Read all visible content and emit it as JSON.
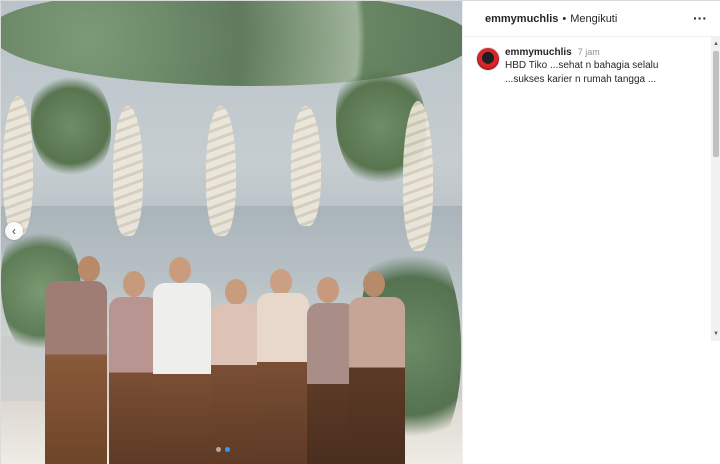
{
  "post": {
    "header": {
      "username": "emmymuchlis",
      "separator": "•",
      "follow_status": "Mengikuti",
      "more_icon": "more-horizontal-icon"
    },
    "comment": {
      "username": "emmymuchlis",
      "time": "7 jam",
      "text": "HBD Tiko ...sehat n bahagia selalu\n...sukses karier n rumah tangga ..."
    },
    "carousel": {
      "prev_icon": "chevron-left-icon",
      "slide_count": 2,
      "active_slide": 2
    }
  },
  "colors": {
    "accent": "#3897f0",
    "text": "#262626",
    "muted": "#8e8e8e"
  }
}
